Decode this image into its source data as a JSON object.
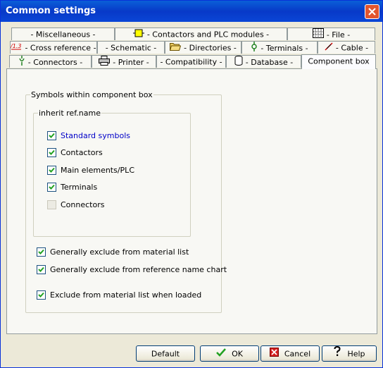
{
  "window": {
    "title": "Common settings"
  },
  "tabs": {
    "row1": [
      {
        "label": "- Miscellaneous -",
        "icon": "none"
      },
      {
        "label": "- Contactors and PLC modules -",
        "icon": "contactor-icon"
      },
      {
        "label": "- File -",
        "icon": "grid-file-icon"
      }
    ],
    "row2": [
      {
        "label": "- Cross reference -",
        "icon": "cross-reference-icon"
      },
      {
        "label": "- Schematic -",
        "icon": "none"
      },
      {
        "label": "- Directories -",
        "icon": "folder-icon"
      },
      {
        "label": "- Terminals -",
        "icon": "terminal-icon"
      },
      {
        "label": "- Cable -",
        "icon": "cable-icon"
      }
    ],
    "row3": [
      {
        "label": "- Connectors -",
        "icon": "connector-icon"
      },
      {
        "label": "- Printer -",
        "icon": "printer-icon"
      },
      {
        "label": "- Compatibility -",
        "icon": "none"
      },
      {
        "label": "- Database -",
        "icon": "database-icon"
      },
      {
        "label": "Component box",
        "icon": "none",
        "active": true
      }
    ]
  },
  "symbols_group": {
    "legend": "Symbols within component box",
    "inherit_group": {
      "legend": "inherit ref.name",
      "options": [
        {
          "label": "Standard symbols",
          "checked": true,
          "enabled": true,
          "focused": true
        },
        {
          "label": "Contactors",
          "checked": true,
          "enabled": true
        },
        {
          "label": "Main elements/PLC",
          "checked": true,
          "enabled": true
        },
        {
          "label": "Terminals",
          "checked": true,
          "enabled": true
        },
        {
          "label": "Connectors",
          "checked": false,
          "enabled": false
        }
      ]
    },
    "options": [
      {
        "label": "Generally exclude from material list",
        "checked": true
      },
      {
        "label": "Generally exclude from reference name chart",
        "checked": true
      },
      {
        "label": "Exclude from material list when loaded",
        "checked": true
      }
    ]
  },
  "buttons": {
    "default": "Default",
    "ok": "OK",
    "cancel": "Cancel",
    "help": "Help"
  },
  "colors": {
    "titlebar": "#0a5fd8",
    "close": "#e2552e",
    "focus_text": "#0000c8",
    "check": "#21a121",
    "cancel_icon": "#d42020"
  }
}
